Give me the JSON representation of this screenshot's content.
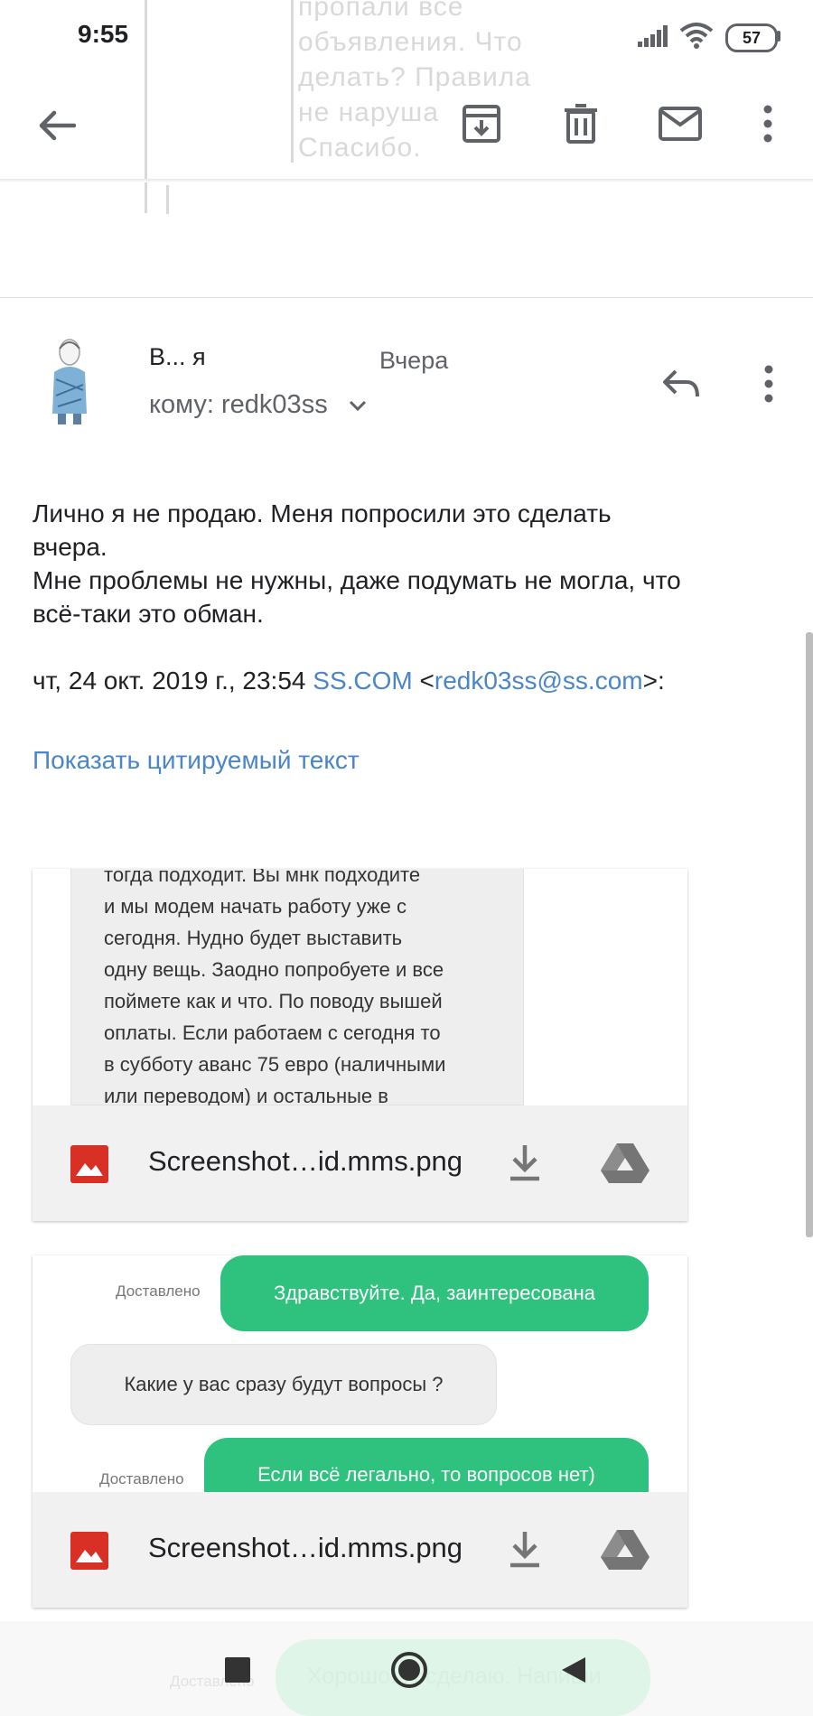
{
  "status_bar": {
    "time": "9:55",
    "battery": "57"
  },
  "background_quote": "пропали все\nобъявления. Что\nделать? Правила\nне наруша\nСпасибо.",
  "toolbar": {
    "back": "arrow-back-icon",
    "archive": "archive-icon",
    "delete": "trash-icon",
    "mark_unread": "mail-icon",
    "more": "more-vert-icon"
  },
  "message": {
    "sender": "В... я",
    "date": "Вчера",
    "recipient_label": "кому: redk03ss",
    "body_lines": [
      "Лично я не продаю. Меня попросили это сделать",
      "вчера.",
      "Мне проблемы не нужны, даже подумать не могла, что",
      "всё-таки это обман."
    ],
    "quote_header": {
      "prefix": "чт, 24 окт. 2019 г., 23:54 ",
      "from_name": "SS.COM",
      "lt": " <",
      "from_email": "redk03ss@ss.com",
      "gt": ">:"
    },
    "show_quoted": "Показать цитируемый текст"
  },
  "attachments": [
    {
      "file_name": "Screenshot…id.mms.png",
      "chat_lines": [
        "тогда подходит. Вы мнк подходите",
        "и мы модем начать работу уже с",
        "сегодня. Нудно будет выставить",
        "одну вещь. Заодно попробуете и все",
        "поймете как и что. По поводу вышей",
        "оплаты. Если работаем с сегодня то",
        "в субботу аванс 75 евро (наличными",
        "или переводом) и остальные в"
      ]
    },
    {
      "file_name": "Screenshot…id.mms.png",
      "delivered_label": "Доставлено",
      "msg1": "Здравствуйте. Да, заинтересована",
      "msg2": "Какие у вас сразу будут вопросы ?",
      "msg3": "Если всё легально, то вопросов нет)"
    }
  ],
  "bottom_ghost": {
    "delivered": "Доставлено",
    "text": "Хорошо. Я сделаю. Напиши"
  },
  "colors": {
    "link": "#4a86c8",
    "green": "#2ec27e",
    "attachment_bar": "#f1f1f1",
    "image_icon_red": "#d93025"
  }
}
